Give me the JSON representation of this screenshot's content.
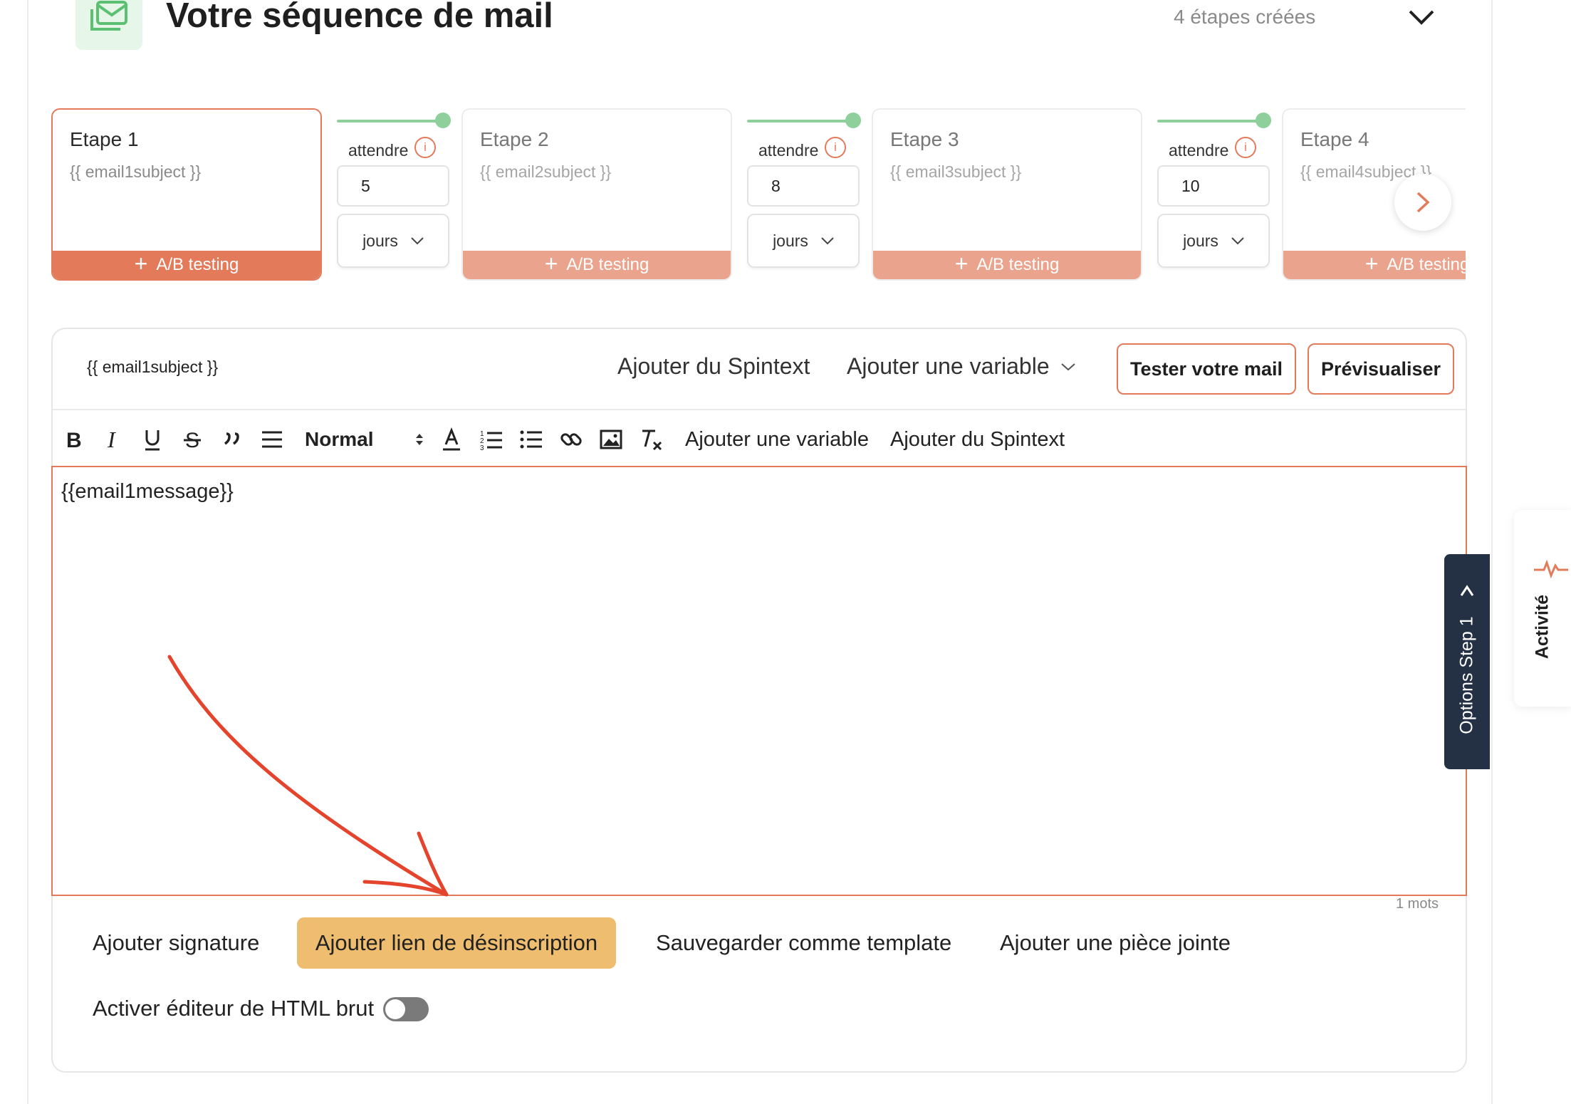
{
  "header": {
    "title": "Votre séquence de mail",
    "steps_count": "4 étapes créées"
  },
  "steps": [
    {
      "title": "Etape 1",
      "subject": "{{ email1subject }}",
      "ab_label": "A/B testing",
      "active": true
    },
    {
      "title": "Etape 2",
      "subject": "{{ email2subject }}",
      "ab_label": "A/B testing",
      "active": false
    },
    {
      "title": "Etape 3",
      "subject": "{{ email3subject }}",
      "ab_label": "A/B testing",
      "active": false
    },
    {
      "title": "Etape 4",
      "subject": "{{ email4subject }}",
      "ab_label": "A/B testing",
      "active": false
    }
  ],
  "waits": [
    {
      "label": "attendre",
      "value": "5",
      "unit": "jours"
    },
    {
      "label": "attendre",
      "value": "8",
      "unit": "jours"
    },
    {
      "label": "attendre",
      "value": "10",
      "unit": "jours"
    }
  ],
  "editor": {
    "subject": "{{ email1subject }}",
    "add_spintext": "Ajouter du Spintext",
    "add_variable": "Ajouter une variable",
    "test_button": "Tester votre mail",
    "preview_button": "Prévisualiser",
    "toolbar": {
      "style_select": "Normal",
      "add_variable": "Ajouter une variable",
      "add_spintext": "Ajouter du Spintext"
    },
    "content": "{{email1message}}",
    "word_count": "1 mots"
  },
  "actions": {
    "add_signature": "Ajouter signature",
    "add_unsubscribe": "Ajouter lien de désinscription",
    "save_template": "Sauvegarder comme template",
    "add_attachment": "Ajouter une pièce jointe",
    "raw_html_label": "Activer éditeur de HTML brut",
    "raw_html_enabled": false
  },
  "side_tabs": {
    "options": "Options Step 1",
    "activity": "Activité"
  },
  "colors": {
    "accent": "#e37b5b",
    "accent_light": "#eaa38d",
    "success": "#8fcf9c",
    "highlight": "#efbd6f",
    "dark_tab": "#243044",
    "annotation": "#e4432c"
  }
}
